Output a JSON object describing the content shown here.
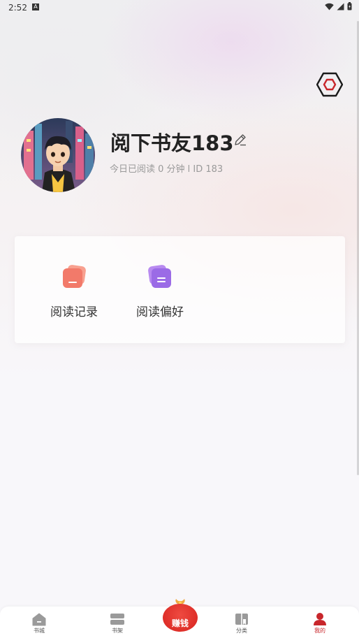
{
  "status_bar": {
    "time": "2:52",
    "a_badge": "A"
  },
  "profile": {
    "username": "阅下书友183",
    "read_info": "今日已阅读 0 分钟 l ID 183"
  },
  "quick_actions": [
    {
      "label": "阅读记录",
      "icon": "reading-history-icon",
      "color": "#f27a6a"
    },
    {
      "label": "阅读偏好",
      "icon": "reading-preference-icon",
      "color": "#9b6be6"
    }
  ],
  "tabbar": {
    "bookcity": "书城",
    "shelf": "书架",
    "earn": "赚钱",
    "category": "分类",
    "mine": "我的"
  },
  "colors": {
    "accent": "#c8262b",
    "settings_icon": "#c8262b"
  }
}
